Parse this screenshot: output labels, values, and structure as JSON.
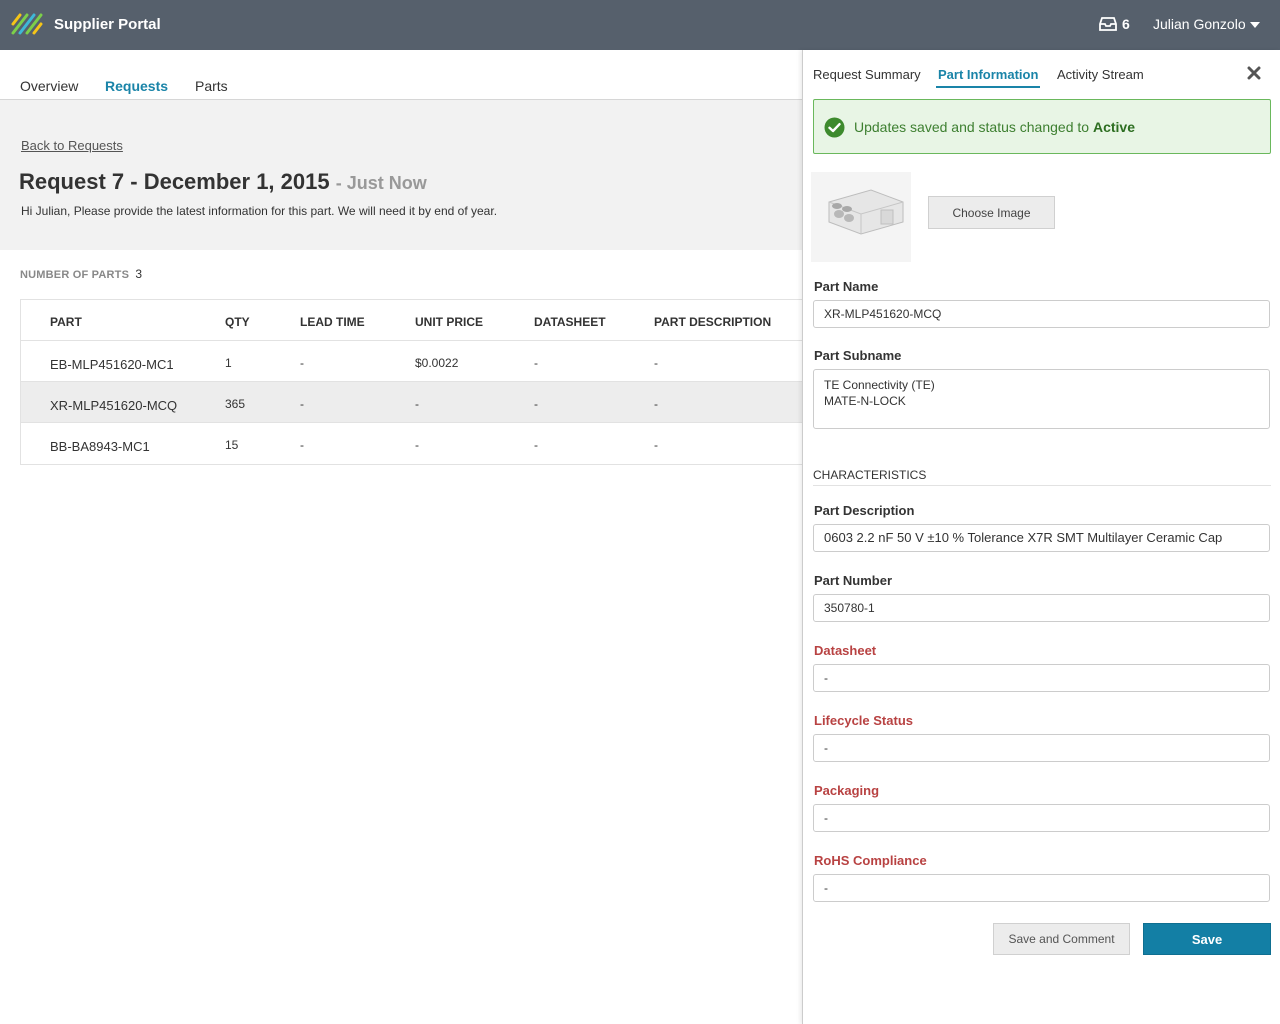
{
  "header": {
    "app_title": "Supplier Portal",
    "inbox_count": "6",
    "user_name": "Julian Gonzolo"
  },
  "main_tabs": [
    {
      "label": "Overview"
    },
    {
      "label": "Requests"
    },
    {
      "label": "Parts"
    }
  ],
  "request": {
    "back_link": "Back to Requests",
    "title": "Request 7 - December 1, 2015",
    "time": "- Just Now",
    "message": "Hi Julian, Please provide the latest information for this part. We will need it by end of year.",
    "parts_count_label": "NUMBER OF PARTS",
    "parts_count": "3"
  },
  "table": {
    "headers": [
      "PART",
      "QTY",
      "LEAD TIME",
      "UNIT PRICE",
      "DATASHEET",
      "PART DESCRIPTION"
    ],
    "rows": [
      {
        "part": "EB-MLP451620-MC1",
        "qty": "1",
        "lead_time": "-",
        "unit_price": "$0.0022",
        "datasheet": "-",
        "description": "-"
      },
      {
        "part": "XR-MLP451620-MCQ",
        "qty": "365",
        "lead_time": "-",
        "unit_price": "-",
        "datasheet": "-",
        "description": "-"
      },
      {
        "part": "BB-BA8943-MC1",
        "qty": "15",
        "lead_time": "-",
        "unit_price": "-",
        "datasheet": "-",
        "description": "-"
      }
    ]
  },
  "panel": {
    "tabs": [
      {
        "label": "Request Summary"
      },
      {
        "label": "Part Information"
      },
      {
        "label": "Activity Stream"
      }
    ],
    "alert_text": "Updates saved and status changed to ",
    "alert_status": "Active",
    "choose_image": "Choose Image",
    "part_name_label": "Part Name",
    "part_name": "XR-MLP451620-MCQ",
    "part_subname_label": "Part Subname",
    "part_subname_line1": "TE Connectivity (TE)",
    "part_subname_line2": "MATE-N-LOCK",
    "characteristics": "CHARACTERISTICS",
    "part_description_label": "Part Description",
    "part_description": "0603 2.2 nF 50 V ±10 % Tolerance X7R SMT Multilayer Ceramic Cap",
    "part_number_label": "Part Number",
    "part_number": "350780-1",
    "datasheet_label": "Datasheet",
    "datasheet": "-",
    "lifecycle_label": "Lifecycle Status",
    "lifecycle": "-",
    "packaging_label": "Packaging",
    "packaging": "-",
    "rohs_label": "RoHS Compliance",
    "rohs": "-",
    "save_comment": "Save and Comment",
    "save": "Save"
  },
  "colors": {
    "topbar": "#56606c",
    "accent": "#1a84a8",
    "save_button": "#137fa5",
    "required_label": "#b84242",
    "success_bg": "#e8f5e5",
    "success_border": "#6ab85c"
  }
}
